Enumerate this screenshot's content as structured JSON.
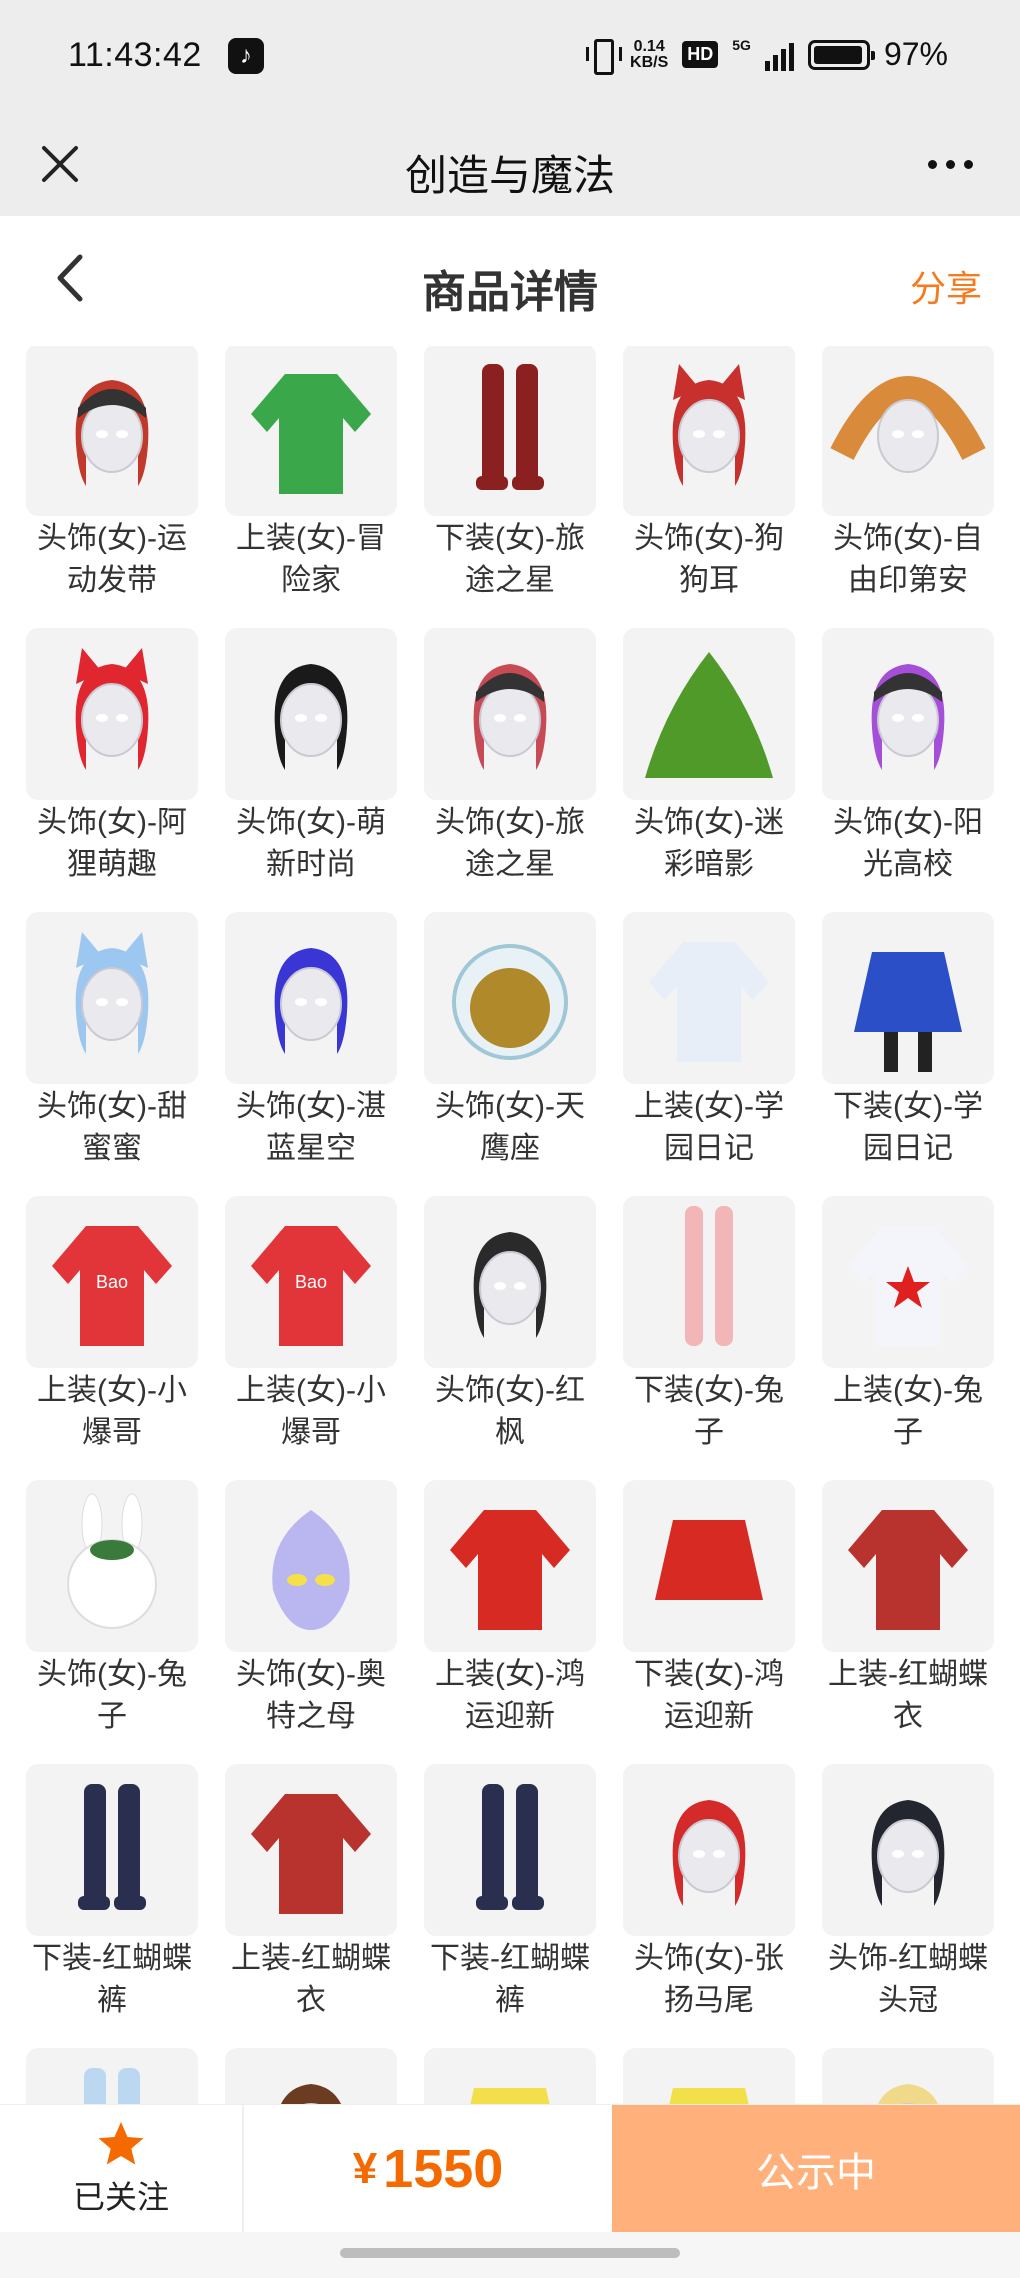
{
  "status_bar": {
    "time": "11:43:42",
    "network_speed_value": "0.14",
    "network_speed_unit": "KB/S",
    "hd": "HD",
    "network_type": "5G",
    "battery": "97%",
    "battery_level": 0.97
  },
  "title_bar": {
    "title": "创造与魔法"
  },
  "page_header": {
    "title": "商品详情",
    "share_label": "分享"
  },
  "items": [
    {
      "label": "头饰(女)-运动发带",
      "icon": "red-bandana-hair",
      "color": "#c0392b"
    },
    {
      "label": "上装(女)-冒险家",
      "icon": "green-jacket",
      "color": "#3aa84a"
    },
    {
      "label": "下装(女)-旅途之星",
      "icon": "red-boots",
      "color": "#8b2020"
    },
    {
      "label": "头饰(女)-狗狗耳",
      "icon": "red-fox-ear-hair",
      "color": "#c8302e"
    },
    {
      "label": "头饰(女)-自由印第安",
      "icon": "feather-headdress",
      "color": "#d98a3a"
    },
    {
      "label": "头饰(女)-阿狸萌趣",
      "icon": "red-cat-headphones",
      "color": "#e0262e"
    },
    {
      "label": "头饰(女)-萌新时尚",
      "icon": "black-bun-hair",
      "color": "#1a1a1a"
    },
    {
      "label": "头饰(女)-旅途之星",
      "icon": "goggles-red-hair",
      "color": "#c74a55"
    },
    {
      "label": "头饰(女)-迷彩暗影",
      "icon": "green-ghillie",
      "color": "#4f9a28"
    },
    {
      "label": "头饰(女)-阳光高校",
      "icon": "purple-hair-beanie",
      "color": "#a54fd9"
    },
    {
      "label": "头饰(女)-甜蜜蜜",
      "icon": "light-blue-cat-ear-hair",
      "color": "#9cc7f0"
    },
    {
      "label": "头饰(女)-湛蓝星空",
      "icon": "blue-hair",
      "color": "#3a36d6"
    },
    {
      "label": "头饰(女)-天鹰座",
      "icon": "gold-helmet",
      "color": "#b08a2a"
    },
    {
      "label": "上装(女)-学园日记",
      "icon": "sailor-top",
      "color": "#e8eef8"
    },
    {
      "label": "下装(女)-学园日记",
      "icon": "blue-pleated-skirt",
      "color": "#2b4fc7"
    },
    {
      "label": "上装(女)-小爆哥",
      "icon": "red-hoodie",
      "color": "#e2353a"
    },
    {
      "label": "上装(女)-小爆哥",
      "icon": "red-hoodie",
      "color": "#e2353a"
    },
    {
      "label": "头饰(女)-红枫",
      "icon": "maple-crown-hair",
      "color": "#2a2a2a"
    },
    {
      "label": "下装(女)-兔子",
      "icon": "pink-legs",
      "color": "#f2b6b6"
    },
    {
      "label": "上装(女)-兔子",
      "icon": "white-star-top",
      "color": "#f4f4fb"
    },
    {
      "label": "头饰(女)-兔子",
      "icon": "white-bunny-head",
      "color": "#ffffff"
    },
    {
      "label": "头饰(女)-奥特之母",
      "icon": "hero-mask",
      "color": "#b9b6f0"
    },
    {
      "label": "上装(女)-鸿运迎新",
      "icon": "red-festive-top",
      "color": "#d62a22"
    },
    {
      "label": "下装(女)-鸿运迎新",
      "icon": "red-festive-skirt",
      "color": "#d62a22"
    },
    {
      "label": "上装-红蝴蝶衣",
      "icon": "red-butterfly-top",
      "color": "#b8332e"
    },
    {
      "label": "下装-红蝴蝶裤",
      "icon": "navy-boots",
      "color": "#2b2f4f"
    },
    {
      "label": "上装-红蝴蝶衣",
      "icon": "red-butterfly-top",
      "color": "#b8332e"
    },
    {
      "label": "下装-红蝴蝶裤",
      "icon": "navy-boots",
      "color": "#2b2f4f"
    },
    {
      "label": "头饰(女)-张扬马尾",
      "icon": "red-ponytail",
      "color": "#d52a2a"
    },
    {
      "label": "头饰-红蝴蝶头冠",
      "icon": "dark-short-hair",
      "color": "#23262e"
    },
    {
      "label": "",
      "icon": "light-blue-boots",
      "color": "#bcd8f0"
    },
    {
      "label": "",
      "icon": "brown-hair",
      "color": "#6b3b22"
    },
    {
      "label": "",
      "icon": "yellow-pants",
      "color": "#f2e04a"
    },
    {
      "label": "",
      "icon": "yellow-pants",
      "color": "#f2e04a"
    },
    {
      "label": "",
      "icon": "blonde-hair",
      "color": "#f1d98a"
    }
  ],
  "bottom_bar": {
    "follow_label": "已关注",
    "price_symbol": "¥",
    "price_value": "1550",
    "status_label": "公示中"
  },
  "colors": {
    "accent": "#f57b1e",
    "price": "#f56a00",
    "status_button": "#ffb07b",
    "star": "#f56a00"
  }
}
